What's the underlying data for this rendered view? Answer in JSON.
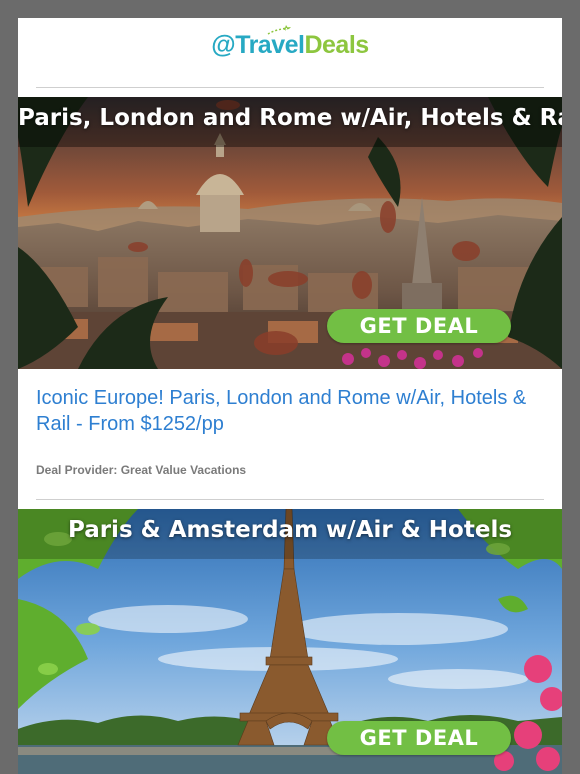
{
  "brand": {
    "logo_at": "@",
    "logo_travel": "Travel",
    "logo_deals": "Deals",
    "colors": {
      "teal": "#27a9c3",
      "green": "#8dc63f"
    }
  },
  "deals": [
    {
      "banner_title": "Paris, London and Rome w/Air, Hotels & Rail",
      "cta_label": "GET DEAL",
      "headline": "Iconic Europe! Paris, London and Rome w/Air, Hotels & Rail - From $1252/pp",
      "provider": "Deal Provider: Great Value Vacations"
    },
    {
      "banner_title": "Paris & Amsterdam w/Air & Hotels",
      "cta_label": "GET DEAL"
    }
  ],
  "colors": {
    "cta": "#72bf44",
    "headline_link": "#2e7fd1",
    "provider_text": "#7a7a7a",
    "frame_background": "#6b6b6b"
  }
}
